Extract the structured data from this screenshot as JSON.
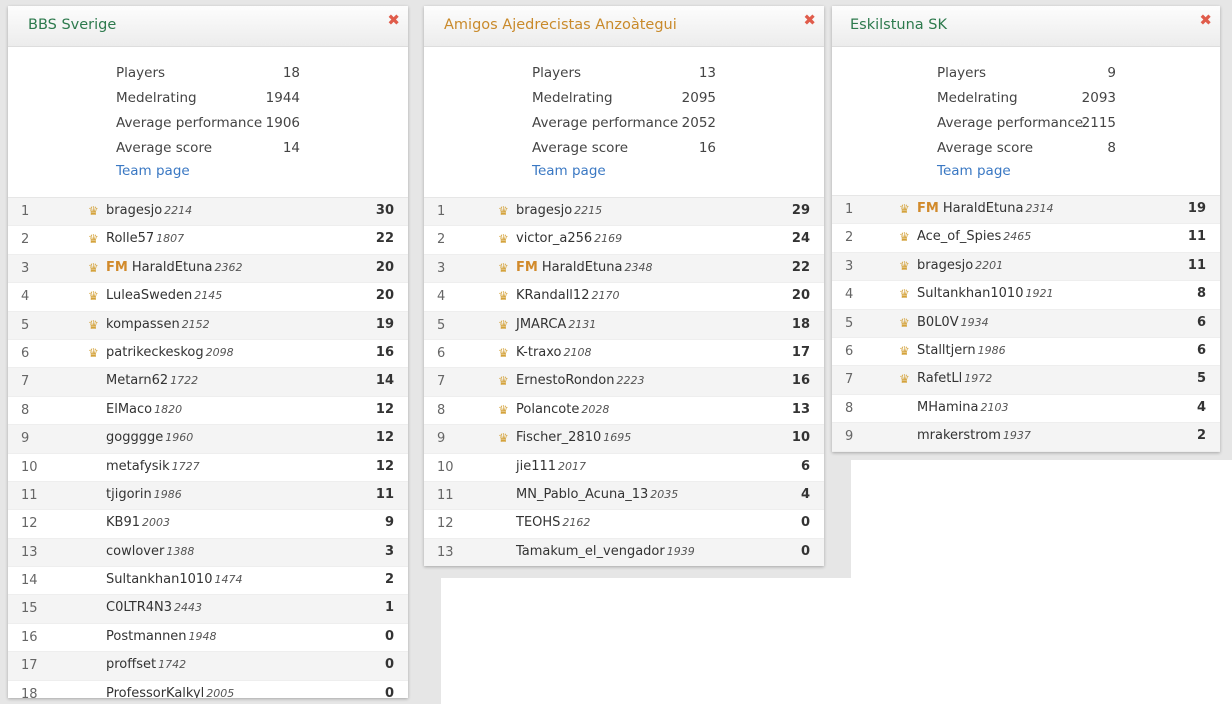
{
  "panels": [
    {
      "title": "BBS Sverige",
      "close": "✖",
      "stats": {
        "players_label": "Players",
        "players": "18",
        "rating_label": "Medelrating",
        "rating": "1944",
        "perf_label": "Average performance",
        "perf": "1906",
        "score_label": "Average score",
        "score": "14",
        "team_page": "Team page"
      },
      "rows": [
        {
          "rank": "1",
          "crown": true,
          "title": "",
          "name": "bragesjo",
          "rating": "2214",
          "score": "30"
        },
        {
          "rank": "2",
          "crown": true,
          "title": "",
          "name": "Rolle57",
          "rating": "1807",
          "score": "22"
        },
        {
          "rank": "3",
          "crown": true,
          "title": "FM",
          "name": "HaraldEtuna",
          "rating": "2362",
          "score": "20"
        },
        {
          "rank": "4",
          "crown": true,
          "title": "",
          "name": "LuleaSweden",
          "rating": "2145",
          "score": "20"
        },
        {
          "rank": "5",
          "crown": true,
          "title": "",
          "name": "kompassen",
          "rating": "2152",
          "score": "19"
        },
        {
          "rank": "6",
          "crown": true,
          "title": "",
          "name": "patrikeckeskog",
          "rating": "2098",
          "score": "16"
        },
        {
          "rank": "7",
          "crown": false,
          "title": "",
          "name": "Metarn62",
          "rating": "1722",
          "score": "14"
        },
        {
          "rank": "8",
          "crown": false,
          "title": "",
          "name": "ElMaco",
          "rating": "1820",
          "score": "12"
        },
        {
          "rank": "9",
          "crown": false,
          "title": "",
          "name": "gogggge",
          "rating": "1960",
          "score": "12"
        },
        {
          "rank": "10",
          "crown": false,
          "title": "",
          "name": "metafysik",
          "rating": "1727",
          "score": "12"
        },
        {
          "rank": "11",
          "crown": false,
          "title": "",
          "name": "tjigorin",
          "rating": "1986",
          "score": "11"
        },
        {
          "rank": "12",
          "crown": false,
          "title": "",
          "name": "KB91",
          "rating": "2003",
          "score": "9"
        },
        {
          "rank": "13",
          "crown": false,
          "title": "",
          "name": "cowlover",
          "rating": "1388",
          "score": "3"
        },
        {
          "rank": "14",
          "crown": false,
          "title": "",
          "name": "Sultankhan1010",
          "rating": "1474",
          "score": "2"
        },
        {
          "rank": "15",
          "crown": false,
          "title": "",
          "name": "C0LTR4N3",
          "rating": "2443",
          "score": "1"
        },
        {
          "rank": "16",
          "crown": false,
          "title": "",
          "name": "Postmannen",
          "rating": "1948",
          "score": "0"
        },
        {
          "rank": "17",
          "crown": false,
          "title": "",
          "name": "proffset",
          "rating": "1742",
          "score": "0"
        },
        {
          "rank": "18",
          "crown": false,
          "title": "",
          "name": "ProfessorKalkyl",
          "rating": "2005",
          "score": "0"
        }
      ]
    },
    {
      "title": "Amigos Ajedrecistas Anzoàtegui",
      "close": "✖",
      "stats": {
        "players_label": "Players",
        "players": "13",
        "rating_label": "Medelrating",
        "rating": "2095",
        "perf_label": "Average performance",
        "perf": "2052",
        "score_label": "Average score",
        "score": "16",
        "team_page": "Team page"
      },
      "rows": [
        {
          "rank": "1",
          "crown": true,
          "title": "",
          "name": "bragesjo",
          "rating": "2215",
          "score": "29"
        },
        {
          "rank": "2",
          "crown": true,
          "title": "",
          "name": "victor_a256",
          "rating": "2169",
          "score": "24"
        },
        {
          "rank": "3",
          "crown": true,
          "title": "FM",
          "name": "HaraldEtuna",
          "rating": "2348",
          "score": "22"
        },
        {
          "rank": "4",
          "crown": true,
          "title": "",
          "name": "KRandall12",
          "rating": "2170",
          "score": "20"
        },
        {
          "rank": "5",
          "crown": true,
          "title": "",
          "name": "JMARCA",
          "rating": "2131",
          "score": "18"
        },
        {
          "rank": "6",
          "crown": true,
          "title": "",
          "name": "K-traxo",
          "rating": "2108",
          "score": "17"
        },
        {
          "rank": "7",
          "crown": true,
          "title": "",
          "name": "ErnestoRondon",
          "rating": "2223",
          "score": "16"
        },
        {
          "rank": "8",
          "crown": true,
          "title": "",
          "name": "Polancote",
          "rating": "2028",
          "score": "13"
        },
        {
          "rank": "9",
          "crown": true,
          "title": "",
          "name": "Fischer_2810",
          "rating": "1695",
          "score": "10"
        },
        {
          "rank": "10",
          "crown": false,
          "title": "",
          "name": "jie111",
          "rating": "2017",
          "score": "6"
        },
        {
          "rank": "11",
          "crown": false,
          "title": "",
          "name": "MN_Pablo_Acuna_13",
          "rating": "2035",
          "score": "4"
        },
        {
          "rank": "12",
          "crown": false,
          "title": "",
          "name": "TEOHS",
          "rating": "2162",
          "score": "0"
        },
        {
          "rank": "13",
          "crown": false,
          "title": "",
          "name": "Tamakum_el_vengador",
          "rating": "1939",
          "score": "0"
        }
      ]
    },
    {
      "title": "Eskilstuna SK",
      "close": "✖",
      "stats": {
        "players_label": "Players",
        "players": "9",
        "rating_label": "Medelrating",
        "rating": "2093",
        "perf_label": "Average performance",
        "perf": "2115",
        "score_label": "Average score",
        "score": "8",
        "team_page": "Team page"
      },
      "rows": [
        {
          "rank": "1",
          "crown": true,
          "title": "FM",
          "name": "HaraldEtuna",
          "rating": "2314",
          "score": "19"
        },
        {
          "rank": "2",
          "crown": true,
          "title": "",
          "name": "Ace_of_Spies",
          "rating": "2465",
          "score": "11"
        },
        {
          "rank": "3",
          "crown": true,
          "title": "",
          "name": "bragesjo",
          "rating": "2201",
          "score": "11"
        },
        {
          "rank": "4",
          "crown": true,
          "title": "",
          "name": "Sultankhan1010",
          "rating": "1921",
          "score": "8"
        },
        {
          "rank": "5",
          "crown": true,
          "title": "",
          "name": "B0L0V",
          "rating": "1934",
          "score": "6"
        },
        {
          "rank": "6",
          "crown": true,
          "title": "",
          "name": "Stalltjern",
          "rating": "1986",
          "score": "6"
        },
        {
          "rank": "7",
          "crown": true,
          "title": "",
          "name": "RafetLl",
          "rating": "1972",
          "score": "5"
        },
        {
          "rank": "8",
          "crown": false,
          "title": "",
          "name": "MHamina",
          "rating": "2103",
          "score": "4"
        },
        {
          "rank": "9",
          "crown": false,
          "title": "",
          "name": "mrakerstrom",
          "rating": "1937",
          "score": "2"
        }
      ]
    }
  ]
}
